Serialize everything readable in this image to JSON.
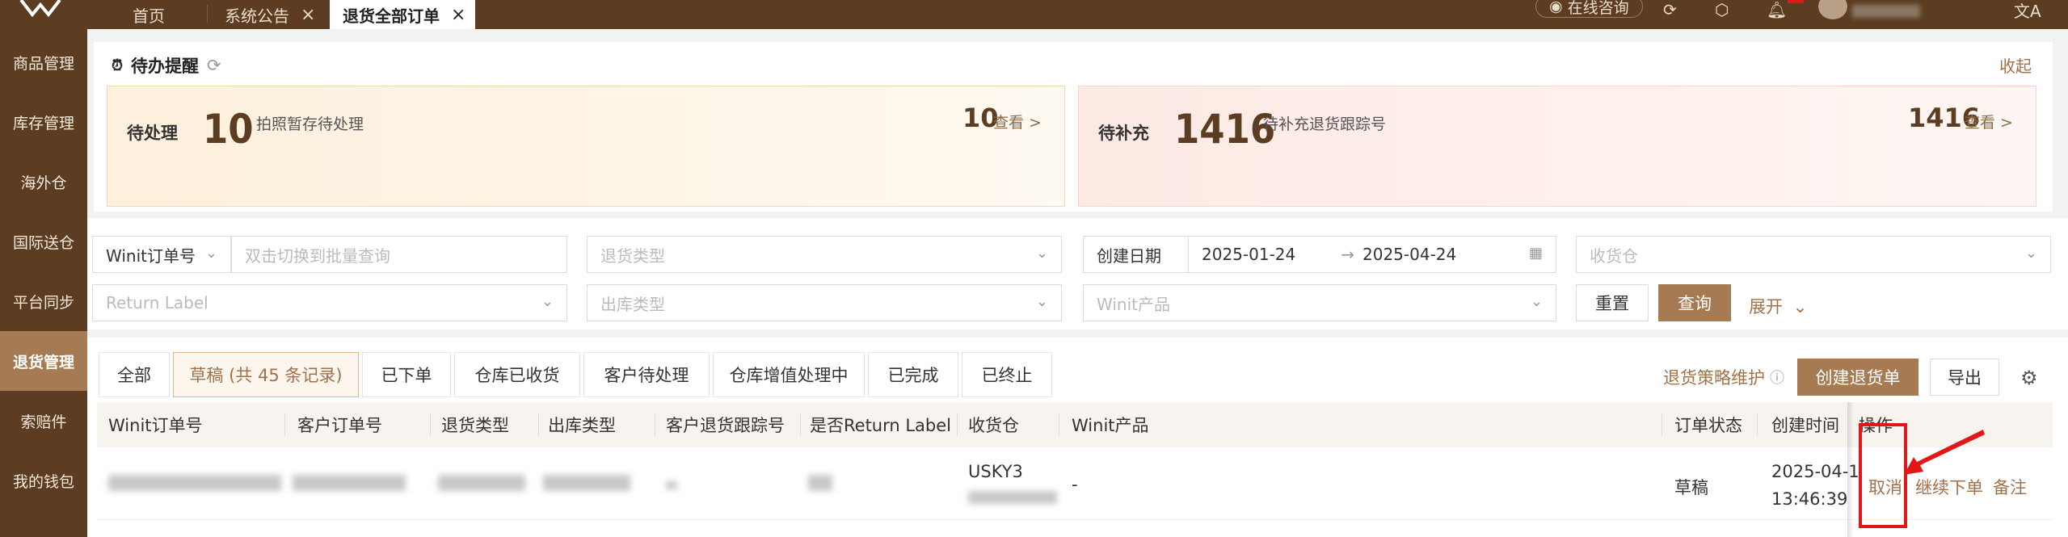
{
  "tabs": [
    {
      "label": "首页",
      "closable": false
    },
    {
      "label": "系统公告",
      "closable": true
    },
    {
      "label": "退货全部订单",
      "closable": true
    }
  ],
  "header": {
    "consult": "在线咨询",
    "translate_icon": "文A"
  },
  "sidebar": {
    "items": [
      "商品管理",
      "库存管理",
      "海外仓",
      "国际送仓",
      "平台同步",
      "退货管理",
      "索赔件",
      "我的钱包"
    ]
  },
  "reminder": {
    "title": "待办提醒",
    "collapse": "收起",
    "cards": [
      {
        "label": "待处理",
        "count": "10",
        "desc": "拍照暂存待处理",
        "right_count": "10",
        "link": "查看 >"
      },
      {
        "label": "待补充",
        "count": "1416",
        "desc": "待补充退货跟踪号",
        "right_count": "1416",
        "link": "查看 >"
      }
    ]
  },
  "filters": {
    "order_type": "Winit订单号",
    "order_placeholder": "双击切换到批量查询",
    "return_type_placeholder": "退货类型",
    "date_label": "创建日期",
    "date_from": "2025-01-24",
    "date_arrow": "→",
    "date_to": "2025-04-24",
    "warehouse_placeholder": "收货仓",
    "return_label_placeholder": "Return Label",
    "outbound_type_placeholder": "出库类型",
    "product_placeholder": "Winit产品",
    "reset": "重置",
    "search": "查询",
    "expand": "展开"
  },
  "status_tabs": [
    "全部",
    "草稿 (共 45 条记录)",
    "已下单",
    "仓库已收货",
    "客户待处理",
    "仓库增值处理中",
    "已完成",
    "已终止"
  ],
  "toolbar": {
    "policy": "退货策略维护",
    "create": "创建退货单",
    "export": "导出"
  },
  "table": {
    "headers": [
      "Winit订单号",
      "客户订单号",
      "退货类型",
      "出库类型",
      "客户退货跟踪号",
      "是否Return Label",
      "收货仓",
      "Winit产品",
      "订单状态",
      "创建时间",
      "操作"
    ],
    "rows": [
      {
        "warehouse": "USKY3",
        "product": "-",
        "status": "草稿",
        "created_date": "2025-04-1",
        "created_time": "13:46:39",
        "actions": [
          "取消",
          "继续下单",
          "备注"
        ]
      }
    ]
  },
  "colors": {
    "brand_dark": "#5c3d21",
    "accent": "#a67b53",
    "highlight": "#e21818"
  }
}
